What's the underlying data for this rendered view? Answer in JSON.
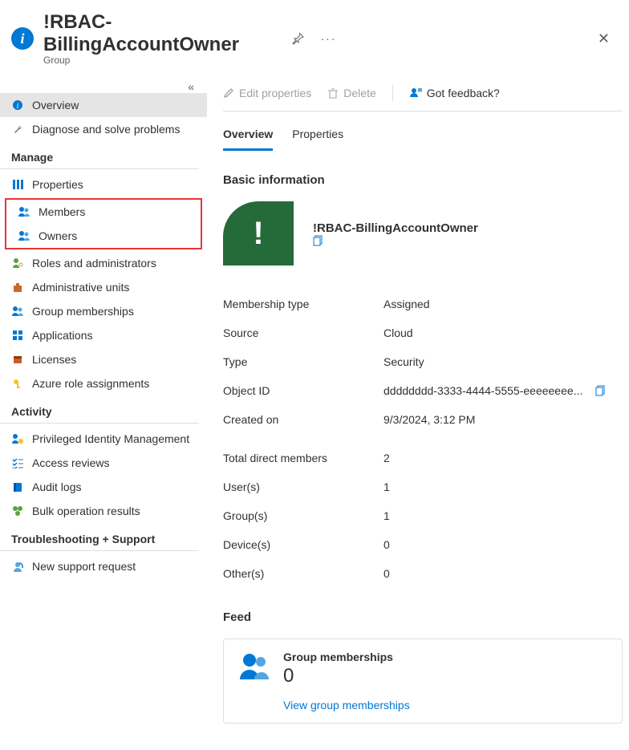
{
  "header": {
    "title": "!RBAC-BillingAccountOwner",
    "subtitle": "Group"
  },
  "sidebar": {
    "top": [
      {
        "icon": "info",
        "label": "Overview",
        "active": true
      },
      {
        "icon": "wrench",
        "label": "Diagnose and solve problems"
      }
    ],
    "manage_label": "Manage",
    "manage": [
      {
        "icon": "props",
        "label": "Properties"
      },
      {
        "icon": "people",
        "label": "Members",
        "hl": true
      },
      {
        "icon": "people",
        "label": "Owners",
        "hl": true
      },
      {
        "icon": "person-key",
        "label": "Roles and administrators"
      },
      {
        "icon": "org",
        "label": "Administrative units"
      },
      {
        "icon": "people",
        "label": "Group memberships"
      },
      {
        "icon": "grid",
        "label": "Applications"
      },
      {
        "icon": "license",
        "label": "Licenses"
      },
      {
        "icon": "key",
        "label": "Azure role assignments"
      }
    ],
    "activity_label": "Activity",
    "activity": [
      {
        "icon": "pim",
        "label": "Privileged Identity Management"
      },
      {
        "icon": "checklist",
        "label": "Access reviews"
      },
      {
        "icon": "book",
        "label": "Audit logs"
      },
      {
        "icon": "bulk",
        "label": "Bulk operation results"
      }
    ],
    "support_label": "Troubleshooting + Support",
    "support": [
      {
        "icon": "support",
        "label": "New support request"
      }
    ]
  },
  "cmdbar": {
    "edit": "Edit properties",
    "delete": "Delete",
    "feedback": "Got feedback?"
  },
  "tabs": {
    "overview": "Overview",
    "properties": "Properties"
  },
  "basic": {
    "section": "Basic information",
    "name": "!RBAC-BillingAccountOwner",
    "membership_type_k": "Membership type",
    "membership_type_v": "Assigned",
    "source_k": "Source",
    "source_v": "Cloud",
    "type_k": "Type",
    "type_v": "Security",
    "objectid_k": "Object ID",
    "objectid_v": "dddddddd-3333-4444-5555-eeeeeeee...",
    "created_k": "Created on",
    "created_v": "9/3/2024, 3:12 PM"
  },
  "counts": {
    "total_k": "Total direct members",
    "total_v": "2",
    "users_k": "User(s)",
    "users_v": "1",
    "groups_k": "Group(s)",
    "groups_v": "1",
    "devices_k": "Device(s)",
    "devices_v": "0",
    "others_k": "Other(s)",
    "others_v": "0"
  },
  "feed": {
    "section": "Feed",
    "card_title": "Group memberships",
    "card_value": "0",
    "link": "View group memberships"
  }
}
